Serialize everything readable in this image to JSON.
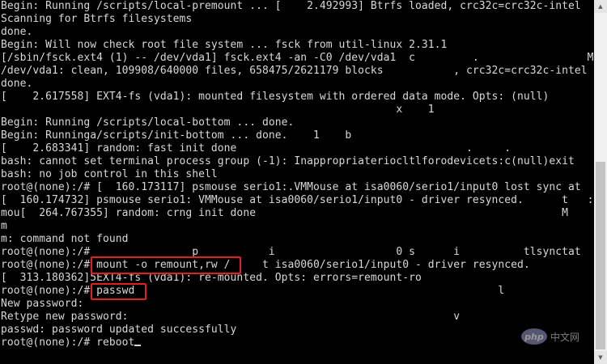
{
  "terminal": {
    "lines": [
      "Begin: Running /scripts/local-premount ... [    2.492993] Btrfs loaded, crc32c=crc32c-intel",
      "Scanning for Btrfs filesystems",
      "done.",
      "Begin: Will now check root file system ... fsck from util-linux 2.31.1",
      "[/sbin/fsck.ext4 (1) -- /dev/vda1] fsck.ext4 -an -C0 /dev/vda1  c         .                 M",
      "/dev/vda1: clean, 109908/640000 files, 658475/2621179 blocks           , crc32c=crc32c-intel",
      "done.",
      "[    2.617558] EXT4-fs (vda1): mounted filesystem with ordered data mode. Opts: (null)",
      "                                                              x    1",
      "Begin: Running /scripts/local-bottom ... done.",
      "Begin: Runninga/scripts/init-bottom ... done.    1    b",
      "[    2.683341] random: fast init done                                    .     .",
      "bash: cannot set terminal process group (-1): Inappropriateriocltlforodevicets:c(null)exit",
      "bash: no job control in this shell",
      "root@(none):/# [  160.173117] psmouse serio1:.VMMouse at isa0060/serio1/input0 lost sync at",
      "[  160.174732] psmouse serio1: VMMouse at isa0060/serio1/input0 - driver resynced.      t   :",
      "mou[  264.767355] random: crng init done                                                M",
      "m",
      "m: command not found",
      "root@(none):/#                p           i                   0 s      i          tlsynctat",
      "root@(none):/# mount -o remount,rw /     t isa0060/serio1/input0 - driver resynced.",
      "[  313.180362]5EXT4-fs (vda1): re-mounted. Opts: errors=remount-ro",
      "root@(none):/# passwd                                                         l",
      "New password:",
      "Retype new password:                                                   v",
      "passwd: password updated successfully",
      "root@(none):/# reboot"
    ]
  },
  "annotations": {
    "box_color": "#e02020"
  },
  "watermark": {
    "logo_text": "php",
    "site_text": "中文网"
  },
  "scrollbar": {
    "up_icon": "triangle-up",
    "down_icon": "triangle-down"
  }
}
